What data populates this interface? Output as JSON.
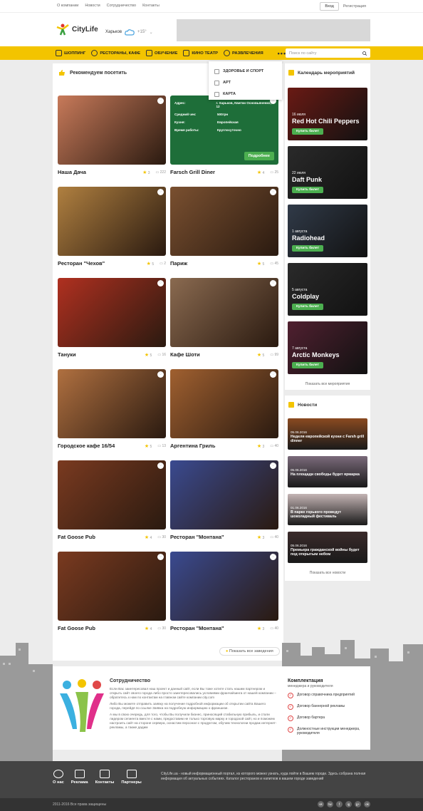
{
  "topbar": {
    "links": [
      "О компании",
      "Новости",
      "Сотрудничество",
      "Контакты"
    ],
    "login": "Вход",
    "register": "Регистрация"
  },
  "header": {
    "logo": "CityLife",
    "city": "Харьков",
    "temp": "+15°"
  },
  "nav": {
    "items": [
      "ШОППИНГ",
      "РЕСТОРАНЫ, КАФЕ",
      "ОБУЧЕНИЕ",
      "КИНО ТЕАТР",
      "РАЗВЛЕЧЕНИЯ"
    ],
    "more": "•••",
    "search_placeholder": "Поиск по сайту"
  },
  "dropdown": [
    "ЗДОРОВЬЕ И СПОРТ",
    "АРТ",
    "КАРТА"
  ],
  "main": {
    "title": "Рекомендуем посетить",
    "show_all": "Показать все заведения",
    "cards": [
      {
        "name": "Наша Дача",
        "rating": "3",
        "comments": "222",
        "color": "#c87a5a"
      },
      {
        "name": "Farsch Grill Diner",
        "rating": "4",
        "comments": "25",
        "info": true
      },
      {
        "name": "Ресторан \"Чехов\"",
        "rating": "5",
        "comments": "2",
        "color": "#b08040"
      },
      {
        "name": "Париж",
        "rating": "5",
        "comments": "45",
        "color": "#7a5030"
      },
      {
        "name": "Тануки",
        "rating": "5",
        "comments": "16",
        "color": "#b03020"
      },
      {
        "name": "Кафе Шоти",
        "rating": "5",
        "comments": "99",
        "color": "#8a6a50"
      },
      {
        "name": "Городское кафе 16/54",
        "rating": "5",
        "comments": "13",
        "color": "#b07040"
      },
      {
        "name": "Аргентина Гриль",
        "rating": "3",
        "comments": "40",
        "color": "#a06030"
      },
      {
        "name": "Fat Goose Pub",
        "rating": "4",
        "comments": "30",
        "color": "#7a3a20"
      },
      {
        "name": "Ресторан \"Монтана\"",
        "rating": "3",
        "comments": "40",
        "color": "#3a4a90"
      },
      {
        "name": "Fat Goose Pub",
        "rating": "4",
        "comments": "30",
        "color": "#7a3a20"
      },
      {
        "name": "Ресторан \"Монтана\"",
        "rating": "3",
        "comments": "40",
        "color": "#3a4a90"
      }
    ],
    "info": {
      "address_k": "Адрес:",
      "address_v": "г. Харьков, Квитки Основьяненко, 12",
      "check_k": "Средний чек:",
      "check_v": "500грн",
      "kitchen_k": "Кухня:",
      "kitchen_v": "Европейская",
      "hours_k": "Время работы:",
      "hours_v": "Круглосуточно",
      "btn": "Подробнее"
    }
  },
  "events": {
    "title": "Календарь мероприятий",
    "buy": "Купить билет",
    "show_all": "Показать все мероприятия",
    "items": [
      {
        "date": "16 июля",
        "name": "Red Hot Chili Peppers",
        "color": "#6a1a14"
      },
      {
        "date": "22 июля",
        "name": "Daft Punk",
        "color": "#2a2a2a"
      },
      {
        "date": "1 августа",
        "name": "Radiohead",
        "color": "#303a48"
      },
      {
        "date": "5 августа",
        "name": "Coldplay",
        "color": "#2a2a2a"
      },
      {
        "date": "7 августа",
        "name": "Arctic Monkeys",
        "color": "#502030"
      }
    ]
  },
  "news": {
    "title": "Новости",
    "show_all": "Показать все новости",
    "items": [
      {
        "date": "05.06.2016",
        "title": "Неделя европейской кухни с Farsh grill dinner",
        "color": "#8a4a20"
      },
      {
        "date": "05.06.2016",
        "title": "На площади свободы будет ярмарка",
        "color": "#7a6a7a"
      },
      {
        "date": "01.06.2016",
        "title": "В парке горького проведут шоколадный фестиваль",
        "color": "#c4b4b4"
      },
      {
        "date": "05.06.2016",
        "title": "Премьера гражданской войны будет под открытым небом",
        "color": "#3a2a2a"
      }
    ]
  },
  "coop": {
    "title": "Сотрудничество",
    "p1": "Если Вас заинтересовал наш проект и данный сайт, если Вы тоже хотите стать нашим партнером и открыть сайт своего города либо просто заинтересовались условиями франчайзинга от нашей компании – обратитесь к нам по контактам на главном сайте компании city.com",
    "p2": "Либо Вы можете отправить заявку на получение подробной информации об открытии сайта Вашего города, перейдя по ссылке Заявка на подробную информацию о франшизе.",
    "p3": "А мы в свою очередь, для того, чтобы Вы получили бизнес, приносящий стабильную прибыль, и стали лидером сегмента вместе с нами, предоставим не только торговую марку и городской сайт, но и поможем настроить сайт на стороне сервера, оснастим персонал с продуктом, обучим технологии продаж интернет-рекламы, а также дадим",
    "kompl_title": "Комплектация",
    "kompl_sub": "менеджера и руководителя",
    "kompl_items": [
      "Договор справочника предприятий",
      "Договор баннерной рекламы",
      "Договор бартера",
      "Должностные инструкции менеджера, руководителя"
    ]
  },
  "footer": {
    "nav": [
      "О нас",
      "Реклама",
      "Контакты",
      "Партнеры"
    ],
    "text": "CityLife.ua - новый информационный портал, из которого можно узнать, куда пойти в Вашем городе. Здесь собрана полная информация об актуальных событиях. Каталог ресторанов и напитков в вашем городе заведений",
    "copyright": "2011-2016 Все права защищены",
    "socials": [
      "vk",
      "tw",
      "f",
      "ig",
      "g+",
      "ok"
    ]
  }
}
